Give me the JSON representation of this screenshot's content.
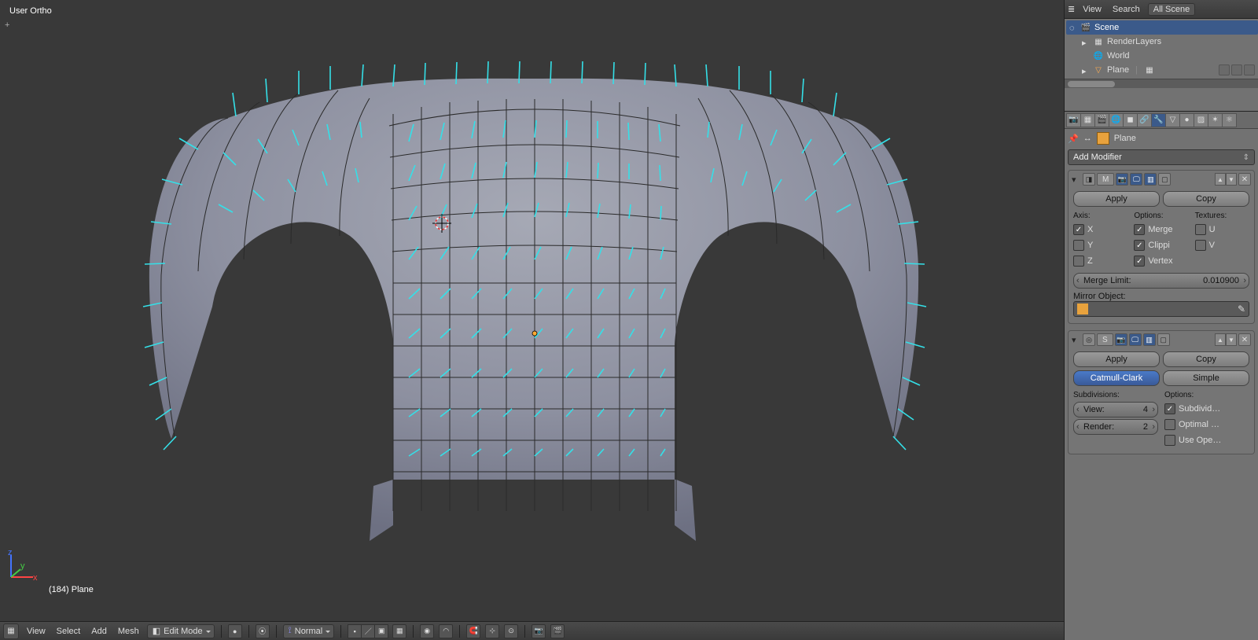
{
  "viewport": {
    "projection_label": "User Ortho",
    "object_selection_label": "(184) Plane"
  },
  "header3d": {
    "view": "View",
    "select": "Select",
    "add": "Add",
    "mesh": "Mesh",
    "mode": "Edit Mode",
    "shading_label": "Normal"
  },
  "outliner_header": {
    "view": "View",
    "search": "Search",
    "filter": "All Scene"
  },
  "outliner": {
    "scene": "Scene",
    "renderlayers": "RenderLayers",
    "world": "World",
    "object": "Plane"
  },
  "properties": {
    "breadcrumb_object": "Plane",
    "add_modifier": "Add Modifier",
    "mirror": {
      "name": "M",
      "apply": "Apply",
      "copy": "Copy",
      "axis_label": "Axis:",
      "options_label": "Options:",
      "textures_label": "Textures:",
      "x": "X",
      "y": "Y",
      "z": "Z",
      "merge": "Merge",
      "clip": "Clippi",
      "vertex": "Vertex",
      "u": "U",
      "v": "V",
      "merge_limit_label": "Merge Limit:",
      "merge_limit_value": "0.010900",
      "mirror_object_label": "Mirror Object:"
    },
    "subsurf": {
      "name": "S",
      "apply": "Apply",
      "copy": "Copy",
      "catmull": "Catmull-Clark",
      "simple": "Simple",
      "subdiv_label": "Subdivisions:",
      "options_label": "Options:",
      "view_label": "View:",
      "view_val": "4",
      "render_label": "Render:",
      "render_val": "2",
      "subdivide": "Subdivid…",
      "optimal": "Optimal …",
      "opensub": "Use Ope…"
    }
  }
}
